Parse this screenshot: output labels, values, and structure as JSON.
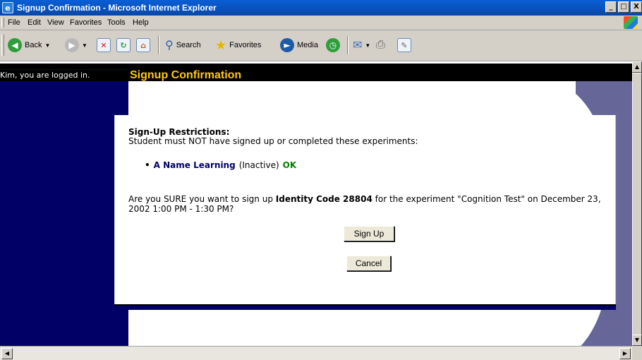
{
  "window": {
    "title": "Signup Confirmation - Microsoft Internet Explorer",
    "controls": [
      "_",
      "□",
      "X"
    ]
  },
  "menu": [
    "File",
    "Edit",
    "View",
    "Favorites",
    "Tools",
    "Help"
  ],
  "toolbar": {
    "back_label": "Back",
    "search_label": "Search",
    "favorites_label": "Favorites",
    "media_label": "Media"
  },
  "page": {
    "logged_in": "Kim, you are logged in.",
    "title": "Signup Confirmation",
    "restrictions_heading": "Sign-Up Restrictions:",
    "restrictions_text": "Student must NOT have signed up or completed these experiments:",
    "experiments": [
      {
        "name": "A Name Learning",
        "status": "(Inactive)",
        "result": "OK"
      }
    ],
    "question": {
      "prefix": "Are you SURE you want to sign up",
      "code": "Identity Code 28804",
      "suffix": "for the experiment \"Cognition Test\" on December 23, 2002 1:00 PM - 1:30 PM?"
    },
    "signup_button": "Sign Up",
    "cancel_button": "Cancel"
  },
  "colors": {
    "nav_panel": "#000066",
    "header_bar": "#000000",
    "page_title": "#ffcc00",
    "right_panel": "#666699",
    "ok": "#008000"
  }
}
